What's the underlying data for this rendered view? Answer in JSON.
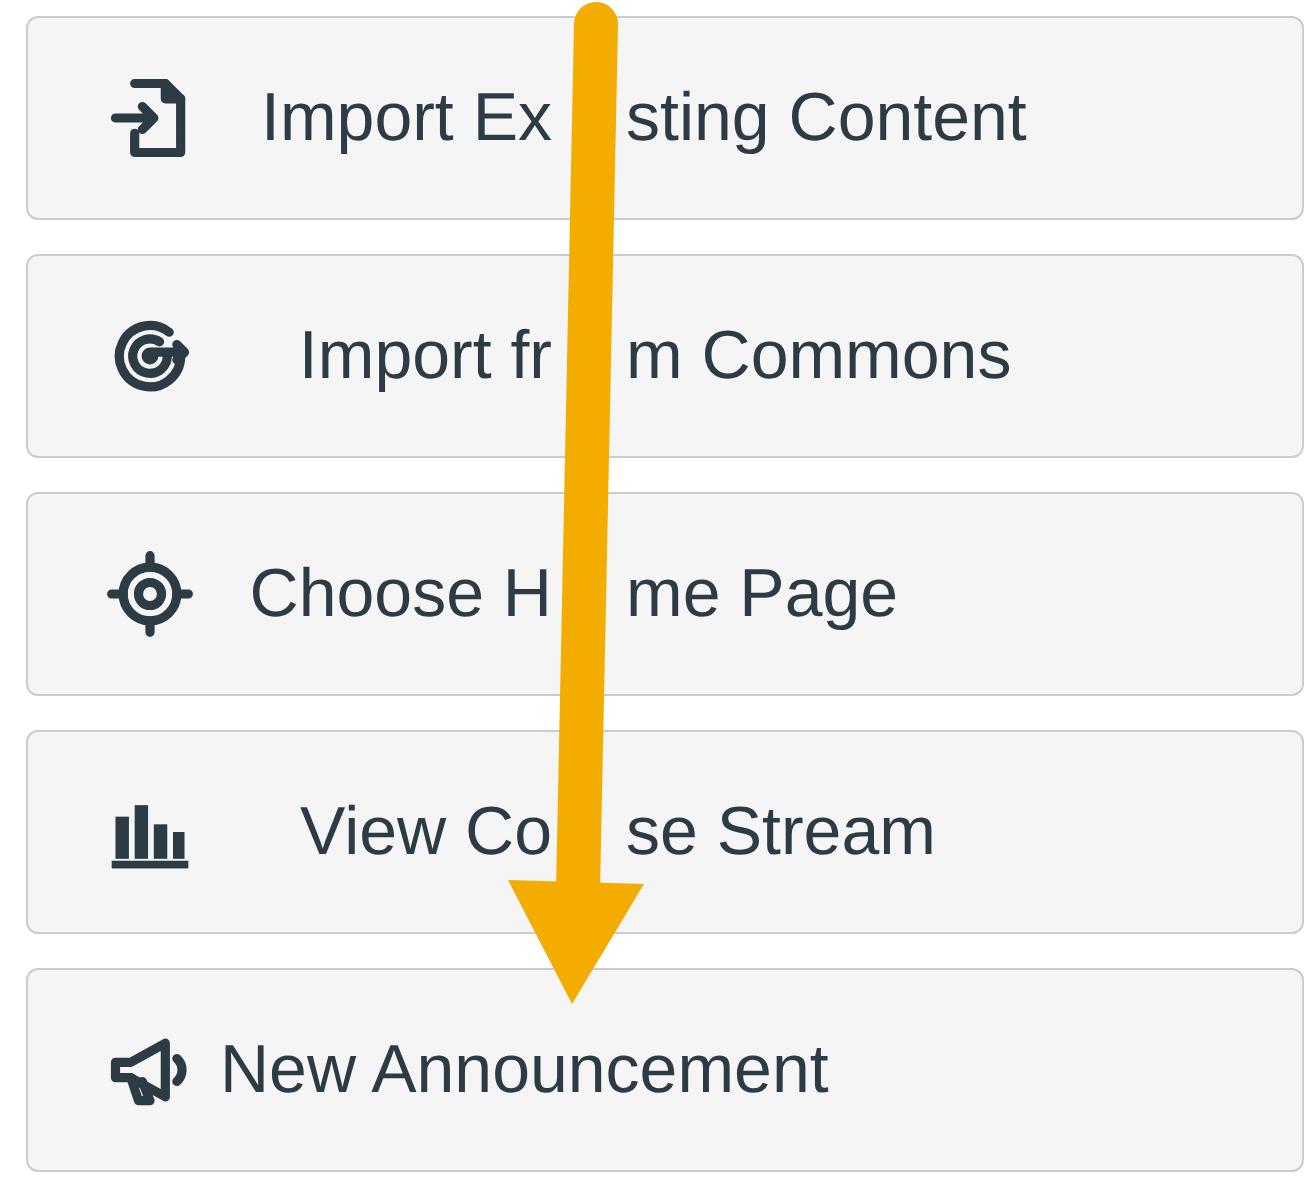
{
  "buttons": [
    {
      "parts": [
        "Import Ex",
        "sting Content"
      ]
    },
    {
      "parts": [
        "Import fr",
        "m Commons"
      ]
    },
    {
      "parts": [
        "Choose H",
        "me Page"
      ]
    },
    {
      "parts": [
        "View Co",
        "se Stream"
      ]
    },
    {
      "parts": [
        "New Announcement"
      ]
    }
  ]
}
